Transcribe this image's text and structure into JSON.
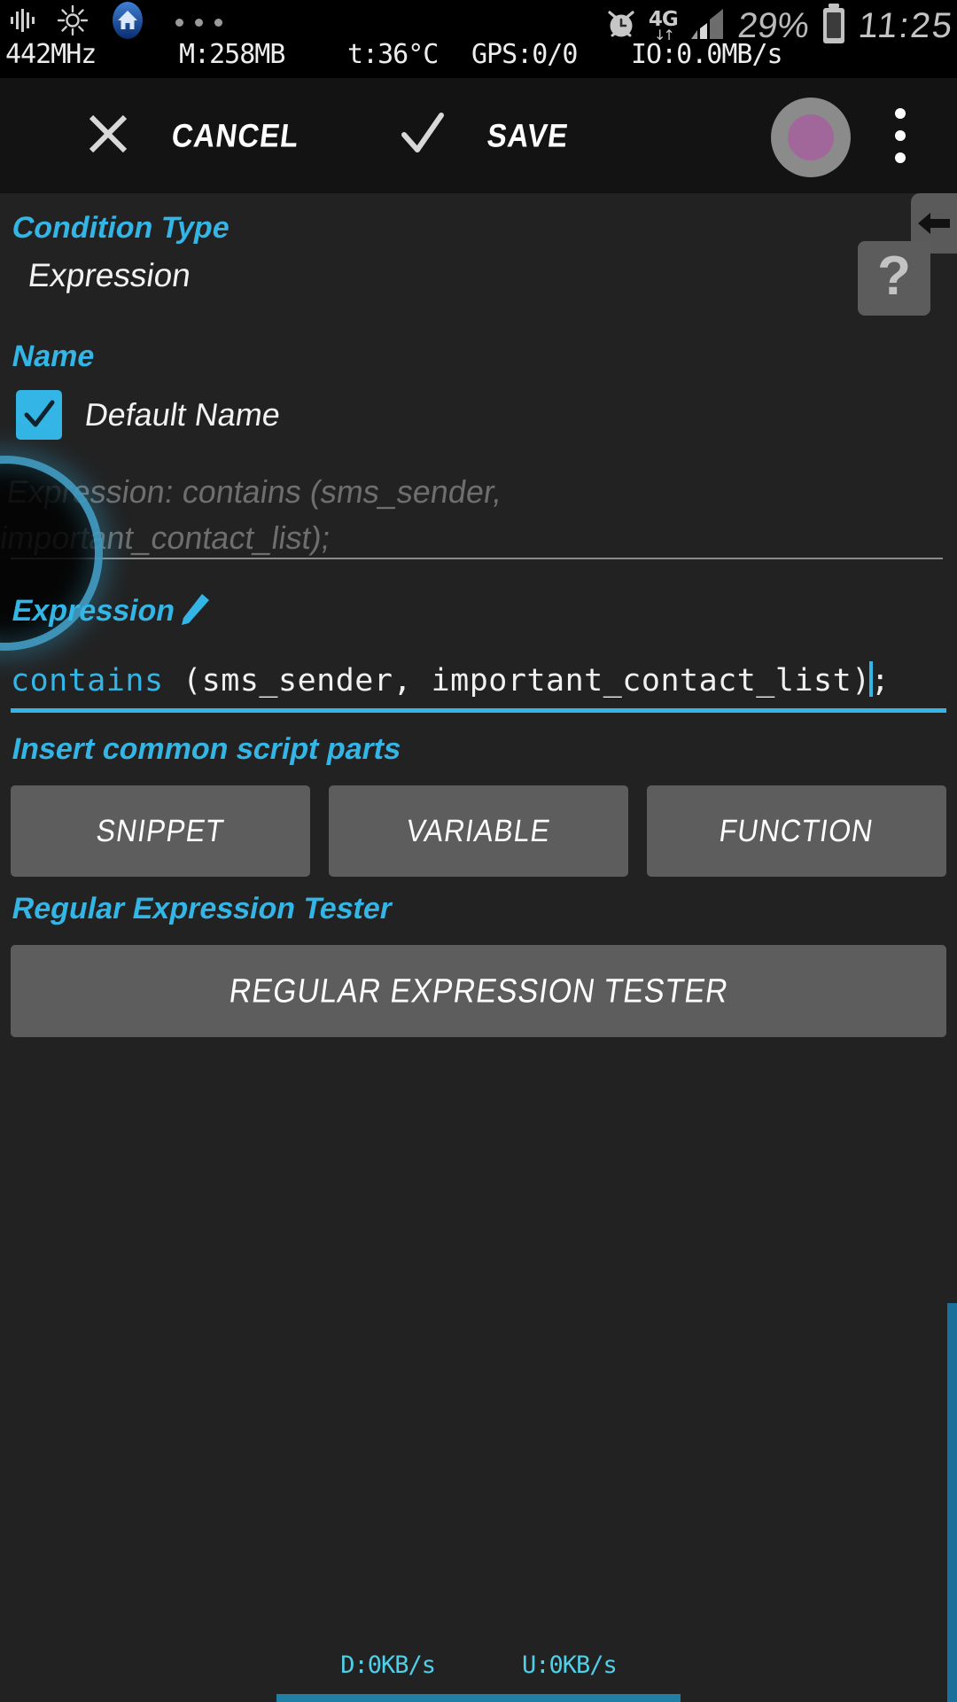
{
  "statusbar": {
    "icons": [
      "equalizer-icon",
      "brightness-icon",
      "home-badge-icon",
      "more-dots-icon"
    ],
    "cpu": "442MHz",
    "memory": "M:258MB",
    "temperature": "t:36°C",
    "gps": "GPS:0/0",
    "io": "IO:0.0MB/s",
    "network_type": "4G",
    "battery_percent": "29%",
    "clock": "11:25",
    "alarm_icon": "alarm-icon",
    "signal_icon": "signal-bars-icon",
    "battery_icon": "battery-icon"
  },
  "toolbar": {
    "cancel_label": "CANCEL",
    "save_label": "SAVE",
    "cancel_icon": "close-icon",
    "save_icon": "check-icon",
    "avatar": "avatar",
    "overflow_icon": "overflow-menu-icon"
  },
  "help": {
    "question_mark": "?",
    "back_tab_icon": "back-arrow-icon"
  },
  "main": {
    "condition_type_label": "Condition Type",
    "condition_type_value": "Expression",
    "name_label": "Name",
    "default_name_label": "Default Name",
    "default_name_checked": true,
    "name_hint": "Expression: contains (sms_sender,\nimportant_contact_list);",
    "expression_label": "Expression",
    "edit_icon": "pencil-icon",
    "expression_code": {
      "function": "contains",
      "args": " (sms_sender, important_contact_list)",
      "terminator": ";"
    },
    "insert_label": "Insert common script parts",
    "insert_buttons": [
      {
        "label": "SNIPPET"
      },
      {
        "label": "VARIABLE"
      },
      {
        "label": "FUNCTION"
      }
    ],
    "regex_tester_label": "Regular Expression Tester",
    "regex_tester_button": "REGULAR EXPRESSION TESTER"
  },
  "footer": {
    "download": "D:0KB/s",
    "upload": "U:0KB/s"
  },
  "colors": {
    "accent": "#33b5e5",
    "background": "#222222",
    "toolbar_bg": "#131313",
    "statusbar_bg": "#000000",
    "button_bg": "#5d5d5d",
    "net_text": "#4fd0e8"
  }
}
